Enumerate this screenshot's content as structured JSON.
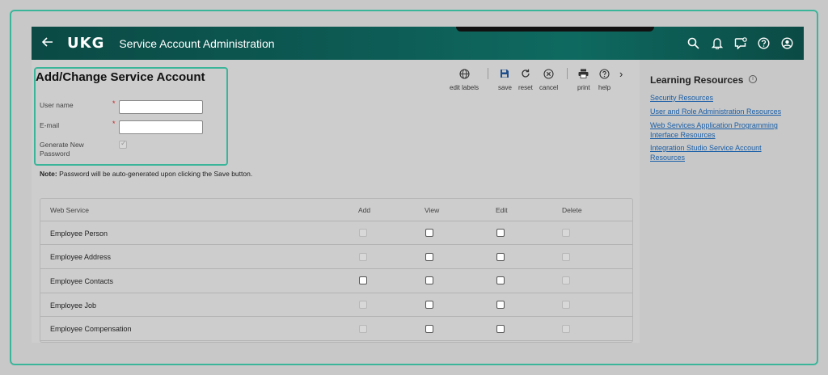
{
  "header": {
    "back_icon": "arrow-left-icon",
    "logo": "UKG",
    "title": "Service Account Administration",
    "icons": [
      "search-icon",
      "bell-icon",
      "chat-icon",
      "help-icon",
      "user-icon"
    ]
  },
  "form": {
    "title": "Add/Change Service Account",
    "username_label": "User name",
    "email_label": "E-mail",
    "gen_password_label_1": "Generate New",
    "gen_password_label_2": "Password",
    "required_mark": "*",
    "username_value": "",
    "email_value": ""
  },
  "note": {
    "prefix": "Note:",
    "text": " Password will be auto-generated upon clicking the Save button."
  },
  "toolbar": {
    "edit_labels": "edit labels",
    "save": "save",
    "reset": "reset",
    "cancel": "cancel",
    "print": "print",
    "help": "help",
    "more": "›"
  },
  "table": {
    "headers": [
      "Web Service",
      "Add",
      "View",
      "Edit",
      "Delete"
    ],
    "rows": [
      {
        "label": "Employee Person",
        "add": "disabled",
        "view": "enabled",
        "edit": "enabled",
        "delete": "disabled"
      },
      {
        "label": "Employee Address",
        "add": "disabled",
        "view": "enabled",
        "edit": "enabled",
        "delete": "disabled"
      },
      {
        "label": "Employee Contacts",
        "add": "enabled",
        "view": "enabled",
        "edit": "enabled",
        "delete": "disabled"
      },
      {
        "label": "Employee Job",
        "add": "disabled",
        "view": "enabled",
        "edit": "enabled",
        "delete": "disabled"
      },
      {
        "label": "Employee Compensation",
        "add": "disabled",
        "view": "enabled",
        "edit": "enabled",
        "delete": "disabled"
      }
    ]
  },
  "learning": {
    "title": "Learning Resources",
    "info": "i",
    "links": [
      {
        "line1": "Security Resources",
        "line2": ""
      },
      {
        "line1": "User and Role Administration Resources",
        "line2": ""
      },
      {
        "line1": "Web Services Application Programming",
        "line2": "Interface Resources"
      },
      {
        "line1": "Integration Studio Service Account",
        "line2": "Resources"
      }
    ]
  },
  "colors": {
    "header_bg": "#0d5c55",
    "accent": "#3bb59a",
    "link": "#1a5fa8"
  }
}
